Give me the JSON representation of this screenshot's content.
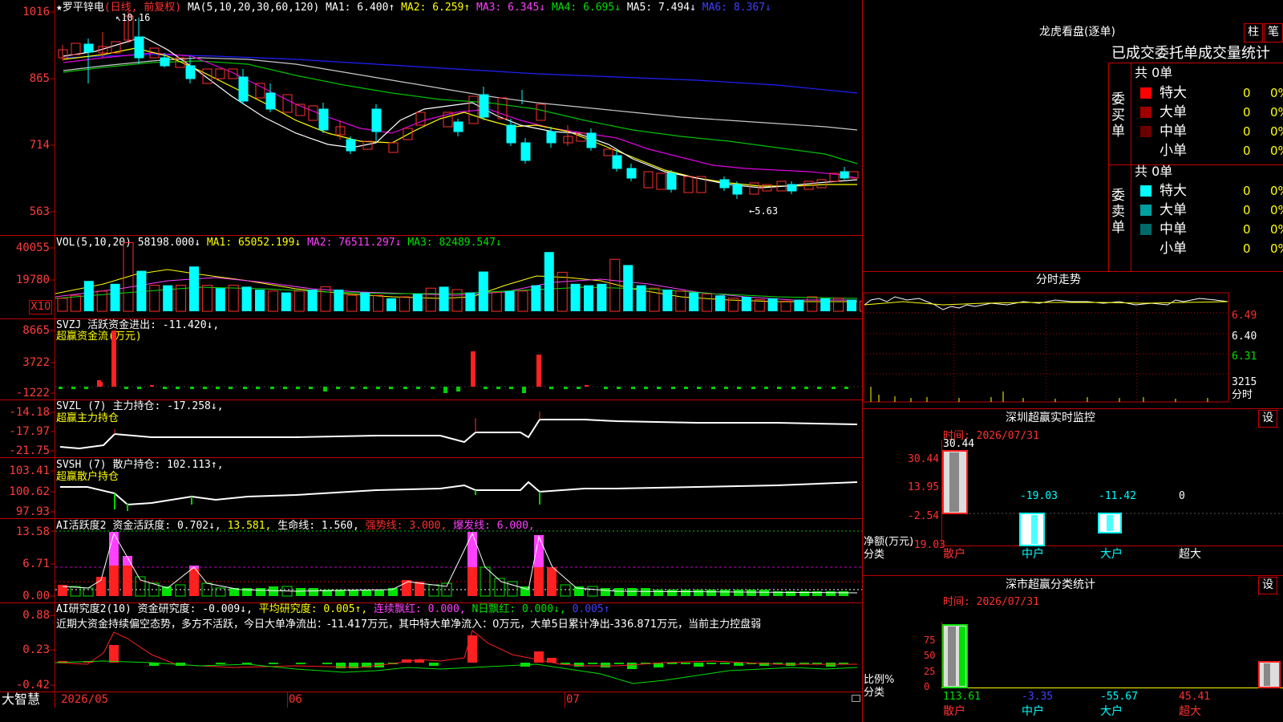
{
  "chart_header": {
    "stock": "★罗平锌电",
    "period": "(日线, 前复权)",
    "ma_label": "MA(5,10,20,30,60,120)",
    "ma1": "MA1: 6.400↑",
    "ma2": "MA2: 6.259↑",
    "ma3": "MA3: 6.345↓",
    "ma4": "MA4: 6.695↓",
    "ma5": "MA5: 7.494↓",
    "ma6": "MA6: 8.367↓",
    "high_mark": "10.16",
    "low_mark": "←5.63",
    "y_labels": [
      "1016",
      "865",
      "714",
      "563"
    ]
  },
  "vol": {
    "title": "VOL(5,10,20)",
    "value": "58198.000↓",
    "ma1": "MA1: 65052.199↓",
    "ma2": "MA2: 76511.297↓",
    "ma3": "MA3: 82489.547↓",
    "y_labels": [
      "40055",
      "19780"
    ],
    "unit": "X10",
    "heights": [
      0.18,
      0.22,
      0.42,
      0.28,
      0.38,
      0.95,
      0.56,
      0.36,
      0.36,
      0.36,
      0.62,
      0.36,
      0.32,
      0.36,
      0.34,
      0.3,
      0.28,
      0.26,
      0.28,
      0.3,
      0.34,
      0.3,
      0.22,
      0.26,
      0.22,
      0.18,
      0.2,
      0.24,
      0.32,
      0.34,
      0.3,
      0.26,
      0.55,
      0.26,
      0.28,
      0.28,
      0.36,
      0.82,
      0.54,
      0.38,
      0.36,
      0.38,
      0.72,
      0.64,
      0.36,
      0.32,
      0.3,
      0.28,
      0.26,
      0.24,
      0.22,
      0.18,
      0.2,
      0.16,
      0.18,
      0.14,
      0.16,
      0.2,
      0.18,
      0.18,
      0.16,
      0.14,
      0.16,
      0.14,
      0.14,
      0.12
    ]
  },
  "svzj": {
    "title": "SVZJ  活跃资金进出: -11.420↓,",
    "sub": "超赢资金流(万元)",
    "y_labels": [
      "8665",
      "3722",
      "-1222"
    ]
  },
  "svzl": {
    "title": "SVZL (7) 主力持仓: -17.258↓,",
    "sub": "超赢主力持仓",
    "y_labels": [
      "-14.18",
      "-17.97",
      "-21.75"
    ]
  },
  "svsh": {
    "title": "SVSH (7) 散户持仓: 102.113↑,",
    "sub": "超赢散户持仓",
    "y_labels": [
      "103.41",
      "100.62",
      "97.93"
    ]
  },
  "ai_active": {
    "title": "AI活跃度2",
    "t1": "资金活跃度: 0.702↓,",
    "t2": "13.581,",
    "t3": "生命线: 1.560,",
    "t4": "强势线: 3.000,",
    "t5": "爆发线: 6.000,",
    "y_labels": [
      "13.58",
      "6.71",
      "0.00"
    ]
  },
  "ai_research": {
    "title": "AI研究度2(10)",
    "t1": "资金研究度: -0.009↓,",
    "t2": "平均研究度: 0.005↑,",
    "t3": "连续飘红: 0.000,",
    "t4": "N日飘红: 0.000↓,",
    "t5": "0.005↑",
    "comment": "近期大资金持续偏空态势，多方不活跃，今日大单净流出：-11.417万元，其中特大单净流入：0万元，大单5日累计净出-336.871万元，当前主力控盘弱",
    "y_labels": [
      "0.88",
      "0.23",
      "-0.42"
    ]
  },
  "x_axis": {
    "logo": "大智慧",
    "labels": [
      "2026/05",
      "06",
      "07"
    ]
  },
  "right": {
    "lhb_title": "龙虎看盘(逐单)",
    "btn_zhu": "柱",
    "btn_bi": "笔",
    "stats_header": "已成交委托单成交量统计",
    "buy": {
      "label": "委买单",
      "count": "共 0单",
      "rows": [
        {
          "name": "特大",
          "val": "0",
          "pct": "0%",
          "color": "#ff0000"
        },
        {
          "name": "大单",
          "val": "0",
          "pct": "0%",
          "color": "#a00000"
        },
        {
          "name": "中单",
          "val": "0",
          "pct": "0%",
          "color": "#6a0000"
        },
        {
          "name": "小单",
          "val": "0",
          "pct": "0%",
          "color": "#000000"
        }
      ]
    },
    "sell": {
      "label": "委卖单",
      "count": "共 0单",
      "rows": [
        {
          "name": "特大",
          "val": "0",
          "pct": "0%",
          "color": "#00ffff"
        },
        {
          "name": "大单",
          "val": "0",
          "pct": "0%",
          "color": "#00a0a0"
        },
        {
          "name": "中单",
          "val": "0",
          "pct": "0%",
          "color": "#006a6a"
        },
        {
          "name": "小单",
          "val": "0",
          "pct": "0%",
          "color": "#000000"
        }
      ]
    },
    "fenshi_title": "分时走势",
    "fenshi_y": [
      "6.49",
      "6.40",
      "6.31"
    ],
    "fenshi_vol": "3215",
    "fenshi_unit": "分时",
    "monitor_title": "深圳超赢实时监控",
    "monitor_time": "时间: 2026/07/31",
    "monitor_y": [
      "30.44",
      "13.95",
      "-2.54",
      "-19.03"
    ],
    "monitor_vals": [
      "30.44",
      "-19.03",
      "-11.42",
      "0"
    ],
    "monitor_unit": "净额(万元)",
    "monitor_cat": "分类",
    "monitor_cats": [
      "散户",
      "中户",
      "大户",
      "超大"
    ],
    "setting": "设",
    "class_title": "深市超赢分类统计",
    "class_time": "时间: 2026/07/31",
    "class_y": [
      "75",
      "50",
      "25",
      "0"
    ],
    "class_vals": [
      "113.61",
      "-3.35",
      "-55.67",
      "45.41"
    ],
    "class_unit": "比例%",
    "class_cat": "分类",
    "class_cats": [
      "散户",
      "中户",
      "大户",
      "超大"
    ]
  }
}
